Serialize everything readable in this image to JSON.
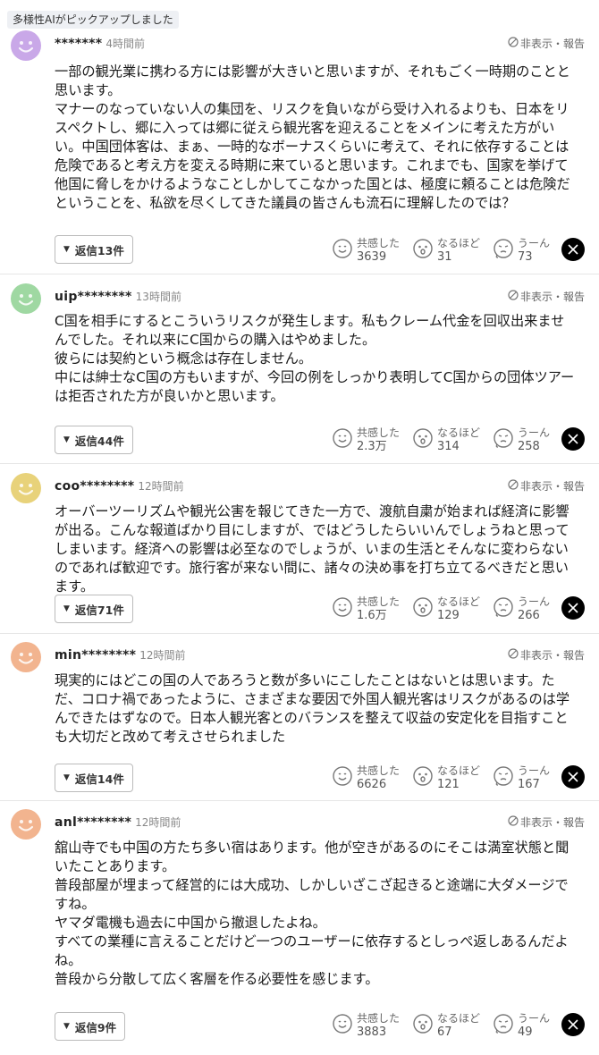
{
  "badge": "多様性AIがピックアップしました",
  "common": {
    "hide_report": "非表示・報告",
    "react_labels": [
      "共感した",
      "なるほど",
      "うーん"
    ],
    "x_icon": "x-logo-icon"
  },
  "comments": [
    {
      "user": "*******",
      "time": "4時間前",
      "avatar_color": "#c9a8e8",
      "text": "一部の観光業に携わる方には影響が大きいと思いますが、それもごく一時期のことと思います。\nマナーのなっていない人の集団を、リスクを負いながら受け入れるよりも、日本をリスペクトし、郷に入っては郷に従えら観光客を迎えることをメインに考えた方がいい。中国団体客は、まぁ、一時的なボーナスくらいに考えて、それに依存することは危険であると考え方を変える時期に来ていると思います。これまでも、国家を挙げて他国に脅しをかけるようなことしかしてこなかった国とは、極度に頼ることは危険だということを、私欲を尽くしてきた議員の皆さんも流石に理解したのでは？",
      "reply": "返信13件",
      "counts": [
        "3639",
        "31",
        "73"
      ]
    },
    {
      "user": "uip********",
      "time": "13時間前",
      "avatar_color": "#9fd8a2",
      "text": "C国を相手にするとこういうリスクが発生します。私もクレーム代金を回収出来ませんでした。それ以来にC国からの購入はやめました。\n彼らには契約という概念は存在しません。\n中には紳士なC国の方もいますが、今回の例をしっかり表明してC国からの団体ツアーは拒否された方が良いかと思います。",
      "reply": "返信44件",
      "counts": [
        "2.3万",
        "314",
        "258"
      ]
    },
    {
      "user": "coo********",
      "time": "12時間前",
      "avatar_color": "#e8d27a",
      "text": "オーバーツーリズムや観光公害を報じてきた一方で、渡航自粛が始まれば経済に影響が出る。こんな報道ばかり目にしますが、ではどうしたらいいんでしょうねと思ってしまいます。経済への影響は必至なのでしょうが、いまの生活とそんなに変わらないのであれば歓迎です。旅行客が来ない間に、諸々の決め事を打ち立てるべきだと思います。",
      "reply": "返信71件",
      "counts": [
        "1.6万",
        "129",
        "266"
      ]
    },
    {
      "user": "min********",
      "time": "12時間前",
      "avatar_color": "#f2b48f",
      "text": "現実的にはどこの国の人であろうと数が多いにこしたことはないとは思います。ただ、コロナ禍であったように、さまざまな要因で外国人観光客はリスクがあるのは学んできたはずなので。日本人観光客とのバランスを整えて収益の安定化を目指すことも大切だと改めて考えさせられました",
      "reply": "返信14件",
      "counts": [
        "6626",
        "121",
        "167"
      ]
    },
    {
      "user": "anl********",
      "time": "12時間前",
      "avatar_color": "#f2b48f",
      "text": "舘山寺でも中国の方たち多い宿はあります。他が空きがあるのにそこは満室状態と聞いたことあります。\n普段部屋が埋まって経営的には大成功、しかしいざこざ起きると途端に大ダメージですね。\nヤマダ電機も過去に中国から撤退したよね。\nすべての業種に言えることだけど一つのユーザーに依存するとしっぺ返しあるんだよね。\n普段から分散して広く客層を作る必要性を感じます。",
      "reply": "返信9件",
      "counts": [
        "3883",
        "67",
        "49"
      ]
    }
  ]
}
